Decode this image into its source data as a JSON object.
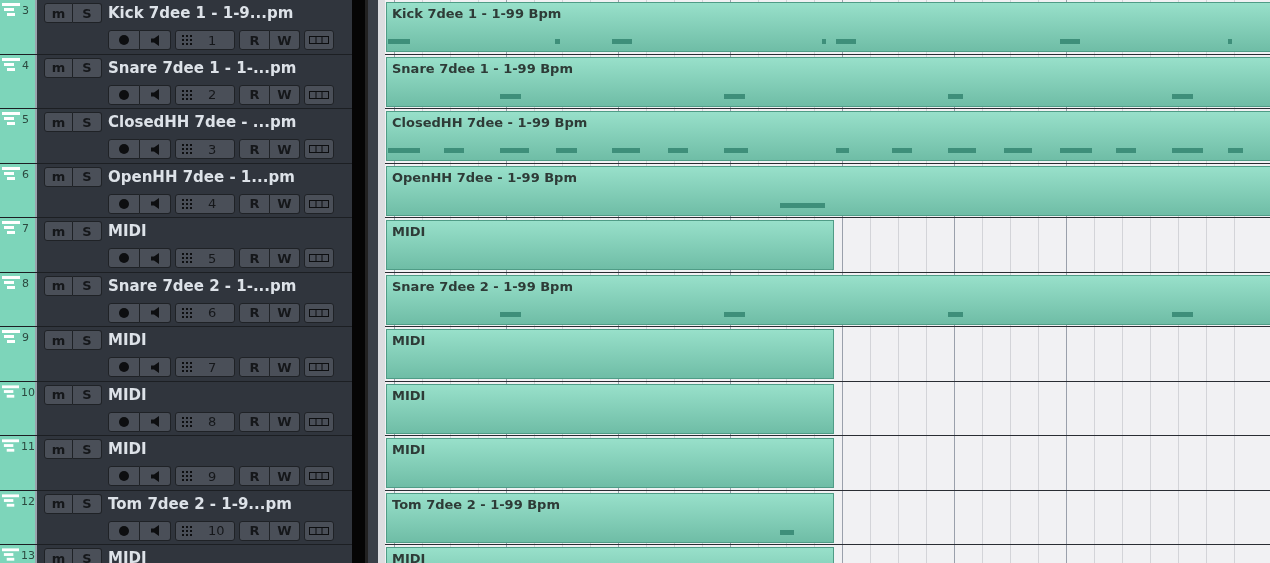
{
  "tracks": [
    {
      "number": "3",
      "name": "Kick 7dee 1 - 1-9...pm",
      "mute": "m",
      "solo": "S",
      "channel": "1",
      "read": "R",
      "write": "W",
      "clip": {
        "name": "Kick 7dee 1 - 1-99 Bpm",
        "kind": "long"
      },
      "notes": {
        "kind": "kick"
      }
    },
    {
      "number": "4",
      "name": "Snare 7dee 1 - 1-...pm",
      "mute": "m",
      "solo": "S",
      "channel": "2",
      "read": "R",
      "write": "W",
      "clip": {
        "name": "Snare 7dee 1 - 1-99 Bpm",
        "kind": "long"
      },
      "notes": {
        "kind": "snare"
      }
    },
    {
      "number": "5",
      "name": "ClosedHH 7dee - ...pm",
      "mute": "m",
      "solo": "S",
      "channel": "3",
      "read": "R",
      "write": "W",
      "clip": {
        "name": "ClosedHH 7dee - 1-99 Bpm",
        "kind": "long"
      },
      "notes": {
        "kind": "hihat"
      }
    },
    {
      "number": "6",
      "name": "OpenHH 7dee - 1...pm",
      "mute": "m",
      "solo": "S",
      "channel": "4",
      "read": "R",
      "write": "W",
      "clip": {
        "name": "OpenHH 7dee - 1-99 Bpm",
        "kind": "long"
      },
      "notes": {
        "kind": "openhat"
      }
    },
    {
      "number": "7",
      "name": "MIDI",
      "mute": "m",
      "solo": "S",
      "channel": "5",
      "read": "R",
      "write": "W",
      "clip": {
        "name": "MIDI",
        "kind": "short"
      }
    },
    {
      "number": "8",
      "name": "Snare 7dee 2 - 1-...pm",
      "mute": "m",
      "solo": "S",
      "channel": "6",
      "read": "R",
      "write": "W",
      "clip": {
        "name": "Snare 7dee 2 - 1-99 Bpm",
        "kind": "long"
      },
      "notes": {
        "kind": "snare"
      }
    },
    {
      "number": "9",
      "name": "MIDI",
      "mute": "m",
      "solo": "S",
      "channel": "7",
      "read": "R",
      "write": "W",
      "clip": {
        "name": "MIDI",
        "kind": "short"
      }
    },
    {
      "number": "10",
      "name": "MIDI",
      "mute": "m",
      "solo": "S",
      "channel": "8",
      "read": "R",
      "write": "W",
      "clip": {
        "name": "MIDI",
        "kind": "short"
      }
    },
    {
      "number": "11",
      "name": "MIDI",
      "mute": "m",
      "solo": "S",
      "channel": "9",
      "read": "R",
      "write": "W",
      "clip": {
        "name": "MIDI",
        "kind": "short"
      }
    },
    {
      "number": "12",
      "name": "Tom 7dee 2 - 1-9...pm",
      "mute": "m",
      "solo": "S",
      "channel": "10",
      "read": "R",
      "write": "W",
      "clip": {
        "name": "Tom 7dee 2 - 1-99 Bpm",
        "kind": "short"
      },
      "notes": {
        "kind": "tom"
      }
    },
    {
      "number": "13",
      "name": "MIDI",
      "mute": "m",
      "solo": "S",
      "clip": {
        "name": "MIDI",
        "kind": "short"
      }
    }
  ]
}
